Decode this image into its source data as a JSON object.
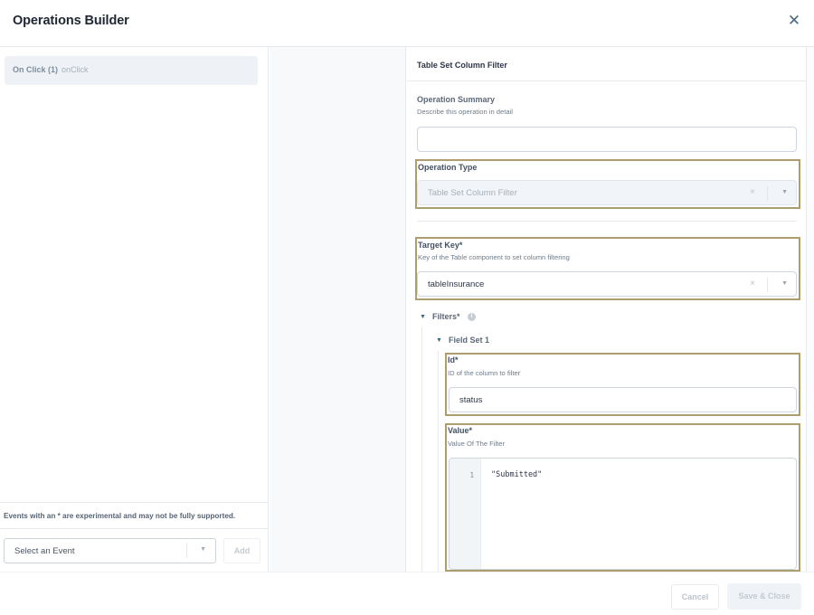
{
  "header": {
    "title": "Operations Builder",
    "close_icon": "close-icon"
  },
  "left": {
    "events": [
      {
        "label": "On Click (1)",
        "key": "onClick"
      }
    ],
    "note": "Events with an * are experimental and may not be fully supported.",
    "event_select": {
      "placeholder": "Select an Event",
      "caret": "▼"
    },
    "add_label": "Add"
  },
  "right": {
    "panel_title": "Table Set Column Filter",
    "operation_summary": {
      "label": "Operation Summary",
      "description": "Describe this operation in detail",
      "value": ""
    },
    "operation_type": {
      "label": "Operation Type",
      "value": "Table Set Column Filter",
      "clear": "×",
      "caret": "▼"
    },
    "target_key": {
      "label": "Target Key*",
      "description": "Key of the Table component to set column filtering",
      "value": "tableInsurance",
      "clear": "×",
      "caret": "▼"
    },
    "filters": {
      "label": "Filters*",
      "caret": "▼",
      "info": "i",
      "field_sets": [
        {
          "label": "Field Set 1",
          "caret": "▼",
          "id": {
            "label": "Id*",
            "description": "ID of the column to filter",
            "value": "status"
          },
          "value": {
            "label": "Value*",
            "description": "Value Of The Filter",
            "line_number": "1",
            "code": "\"Submitted\""
          }
        }
      ]
    }
  },
  "footer": {
    "cancel_label": "Cancel",
    "save_label": "Save & Close"
  },
  "colors": {
    "highlight_border": "#ad9d6f",
    "selected_event_bg": "#eef2f6",
    "tree_caret": "#3d6a86"
  }
}
